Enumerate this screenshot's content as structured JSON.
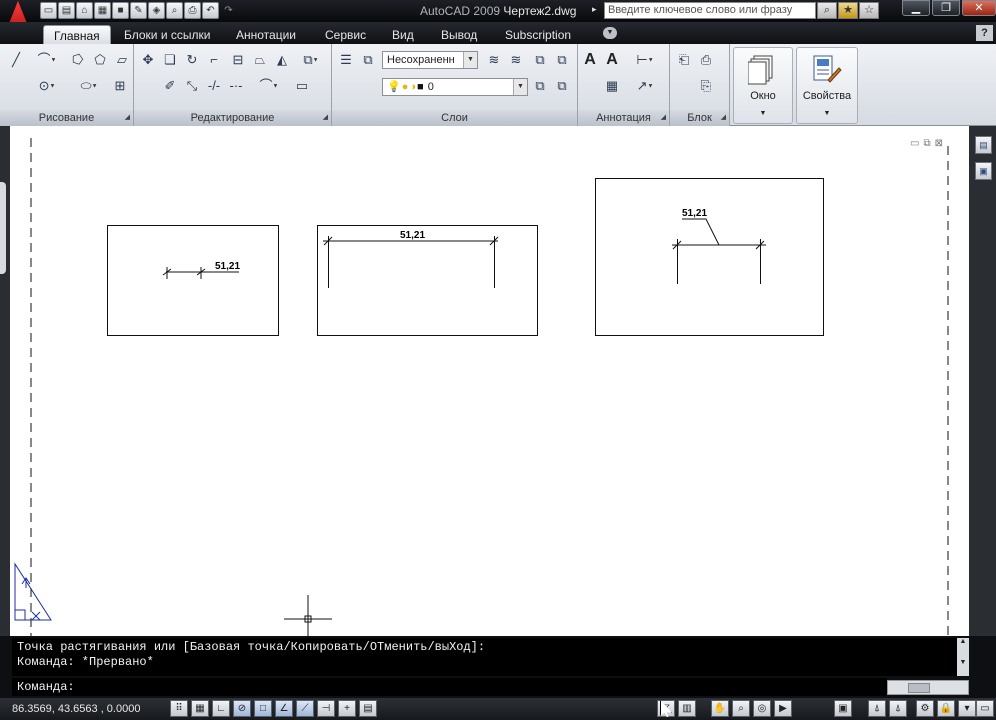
{
  "titlebar": {
    "app_version": "AutoCAD 2009",
    "document_name": "Чертеж2.dwg",
    "search_placeholder": "Введите ключевое слово или фразу"
  },
  "quick_access": {
    "icons": [
      "new-icon",
      "open-icon",
      "open-folder-icon",
      "save-as-icon",
      "save-icon",
      "edit-icon",
      "layers-icon",
      "zoom-icon",
      "print-icon",
      "undo-icon",
      "redo-icon"
    ]
  },
  "tabs": [
    "Главная",
    "Блоки и ссылки",
    "Аннотации",
    "Сервис",
    "Вид",
    "Вывод",
    "Subscription"
  ],
  "active_tab": "Главная",
  "ribbon": {
    "panels": {
      "draw": "Рисование",
      "modify": "Редактирование",
      "layers": "Слои",
      "annotation": "Аннотация",
      "block": "Блок"
    },
    "layer_state_value": "Несохраненн",
    "layer_value": "0",
    "window_button": "Окно",
    "properties_button": "Свойства"
  },
  "drawing": {
    "dimension_text": "51,21"
  },
  "command": {
    "history_line1": "Точка растягивания или [Базовая точка/Копировать/ОТменить/выХод]:",
    "history_line2": "Команда: *Прервано*",
    "prompt": "Команда:"
  },
  "status": {
    "coordinates": "86.3569, 43.6563 , 0.0000"
  },
  "colors": {
    "accent": "#1e2126",
    "logo_red": "#d81e1e",
    "ucs_blue": "#1c2ea8"
  }
}
